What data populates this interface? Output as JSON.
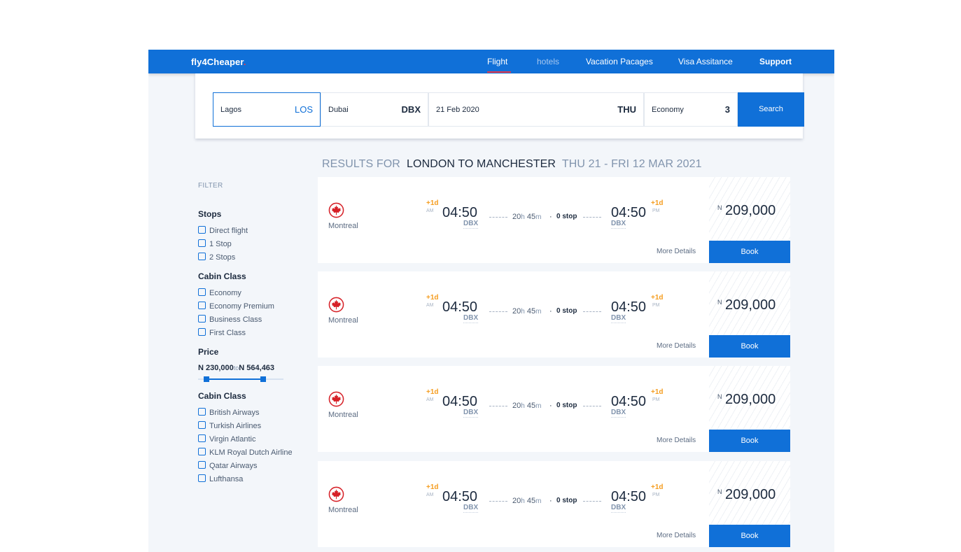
{
  "brand": {
    "name": "fly4Cheaper",
    "dot": "."
  },
  "nav": {
    "items": [
      "Flight",
      "hotels",
      "Vacation Pacages",
      "Visa Assitance",
      "Support"
    ]
  },
  "search": {
    "from": {
      "city": "Lagos",
      "code": "LOS"
    },
    "to": {
      "city": "Dubai",
      "code": "DBX"
    },
    "date": {
      "value": "21 Feb 2020",
      "day": "THU"
    },
    "cabin": {
      "value": "Economy",
      "passengers": "3"
    },
    "button_label": "Search"
  },
  "results_heading": {
    "prefix": "RESULTS FOR",
    "route": "LONDON TO MANCHESTER",
    "dates": "THU 21 - FRI 12 MAR 2021"
  },
  "filter": {
    "title": "FILTER",
    "stops": {
      "title": "Stops",
      "options": [
        "Direct flight",
        "1 Stop",
        "2 Stops"
      ]
    },
    "cabin": {
      "title": "Cabin Class",
      "options": [
        "Economy",
        "Economy Premium",
        "Business Class",
        "First Class"
      ]
    },
    "price": {
      "title": "Price",
      "min": "N 230,000",
      "to": "to",
      "max": "N 564,463",
      "range_fraction": [
        0.1,
        0.76
      ]
    },
    "airlines": {
      "title": "Cabin Class",
      "options": [
        "British Airways",
        "Turkish Airlines",
        "Virgin Atlantic",
        "KLM Royal Dutch Airlines",
        "Qatar Airways",
        "Lufthansa"
      ]
    }
  },
  "colors": {
    "primary": "#1070d8",
    "accent": "#e8374a",
    "plus_day": "#f59d20"
  },
  "results": [
    {
      "airline_icon": "maple-leaf-icon",
      "airline": "Montreal",
      "dep_plus": "+1d",
      "dep_ampm": "AM",
      "dep_time": "04:50",
      "dep_code": "DBX",
      "duration_h": "20",
      "duration_m": "45",
      "h": "h",
      "m": "m",
      "dot": "·",
      "stops": "0 stop",
      "arr_plus": "+1d",
      "arr_ampm": "PM",
      "arr_time": "04:50",
      "arr_code": "DBX",
      "currency": "N",
      "price": "209,000",
      "more": "More Details",
      "book": "Book"
    },
    {
      "airline_icon": "maple-leaf-icon",
      "airline": "Montreal",
      "dep_plus": "+1d",
      "dep_ampm": "AM",
      "dep_time": "04:50",
      "dep_code": "DBX",
      "duration_h": "20",
      "duration_m": "45",
      "h": "h",
      "m": "m",
      "dot": "·",
      "stops": "0 stop",
      "arr_plus": "+1d",
      "arr_ampm": "PM",
      "arr_time": "04:50",
      "arr_code": "DBX",
      "currency": "N",
      "price": "209,000",
      "more": "More Details",
      "book": "Book"
    },
    {
      "airline_icon": "maple-leaf-icon",
      "airline": "Montreal",
      "dep_plus": "+1d",
      "dep_ampm": "AM",
      "dep_time": "04:50",
      "dep_code": "DBX",
      "duration_h": "20",
      "duration_m": "45",
      "h": "h",
      "m": "m",
      "dot": "·",
      "stops": "0 stop",
      "arr_plus": "+1d",
      "arr_ampm": "PM",
      "arr_time": "04:50",
      "arr_code": "DBX",
      "currency": "N",
      "price": "209,000",
      "more": "More Details",
      "book": "Book"
    },
    {
      "airline_icon": "maple-leaf-icon",
      "airline": "Montreal",
      "dep_plus": "+1d",
      "dep_ampm": "AM",
      "dep_time": "04:50",
      "dep_code": "DBX",
      "duration_h": "20",
      "duration_m": "45",
      "h": "h",
      "m": "m",
      "dot": "·",
      "stops": "0 stop",
      "arr_plus": "+1d",
      "arr_ampm": "PM",
      "arr_time": "04:50",
      "arr_code": "DBX",
      "currency": "N",
      "price": "209,000",
      "more": "More Details",
      "book": "Book"
    }
  ]
}
